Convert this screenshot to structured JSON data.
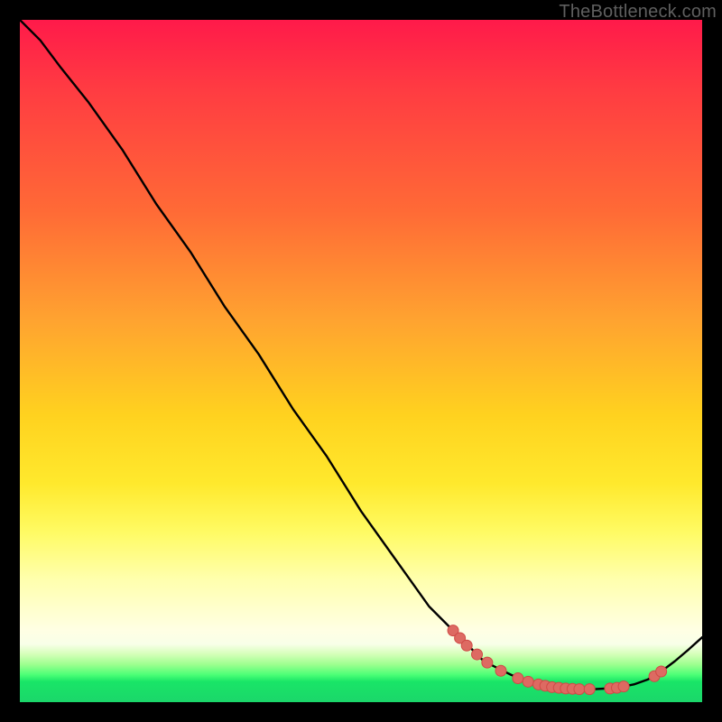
{
  "watermark": "TheBottleneck.com",
  "colors": {
    "curve_stroke": "#000000",
    "marker_fill": "#dd6a62",
    "marker_stroke": "#cf4a46"
  },
  "chart_data": {
    "type": "line",
    "title": "",
    "xlabel": "",
    "ylabel": "",
    "xlim": [
      0,
      100
    ],
    "ylim": [
      0,
      100
    ],
    "grid": false,
    "legend": false,
    "series": [
      {
        "name": "curve",
        "x": [
          0,
          3,
          6,
          10,
          15,
          20,
          25,
          30,
          35,
          40,
          45,
          50,
          55,
          60,
          63,
          66,
          68,
          70,
          72,
          74,
          76,
          78,
          80,
          82,
          84,
          86,
          88,
          90,
          92,
          94,
          96,
          98,
          100
        ],
        "y": [
          100,
          97,
          93,
          88,
          81,
          73,
          66,
          58,
          51,
          43,
          36,
          28,
          21,
          14,
          11,
          8,
          6,
          5,
          4,
          3.2,
          2.6,
          2.2,
          2.0,
          1.9,
          1.9,
          2.0,
          2.2,
          2.6,
          3.3,
          4.5,
          6.0,
          7.7,
          9.5
        ]
      }
    ],
    "markers": [
      {
        "x": 63.5,
        "y": 10.5
      },
      {
        "x": 64.5,
        "y": 9.4
      },
      {
        "x": 65.5,
        "y": 8.3
      },
      {
        "x": 67.0,
        "y": 7.0
      },
      {
        "x": 68.5,
        "y": 5.8
      },
      {
        "x": 70.5,
        "y": 4.6
      },
      {
        "x": 73.0,
        "y": 3.5
      },
      {
        "x": 74.5,
        "y": 3.0
      },
      {
        "x": 76.0,
        "y": 2.6
      },
      {
        "x": 77.0,
        "y": 2.4
      },
      {
        "x": 78.0,
        "y": 2.2
      },
      {
        "x": 79.0,
        "y": 2.1
      },
      {
        "x": 80.0,
        "y": 2.0
      },
      {
        "x": 81.0,
        "y": 1.95
      },
      {
        "x": 82.0,
        "y": 1.9
      },
      {
        "x": 83.5,
        "y": 1.9
      },
      {
        "x": 86.5,
        "y": 2.0
      },
      {
        "x": 87.5,
        "y": 2.1
      },
      {
        "x": 88.5,
        "y": 2.3
      },
      {
        "x": 93.0,
        "y": 3.8
      },
      {
        "x": 94.0,
        "y": 4.5
      }
    ]
  }
}
